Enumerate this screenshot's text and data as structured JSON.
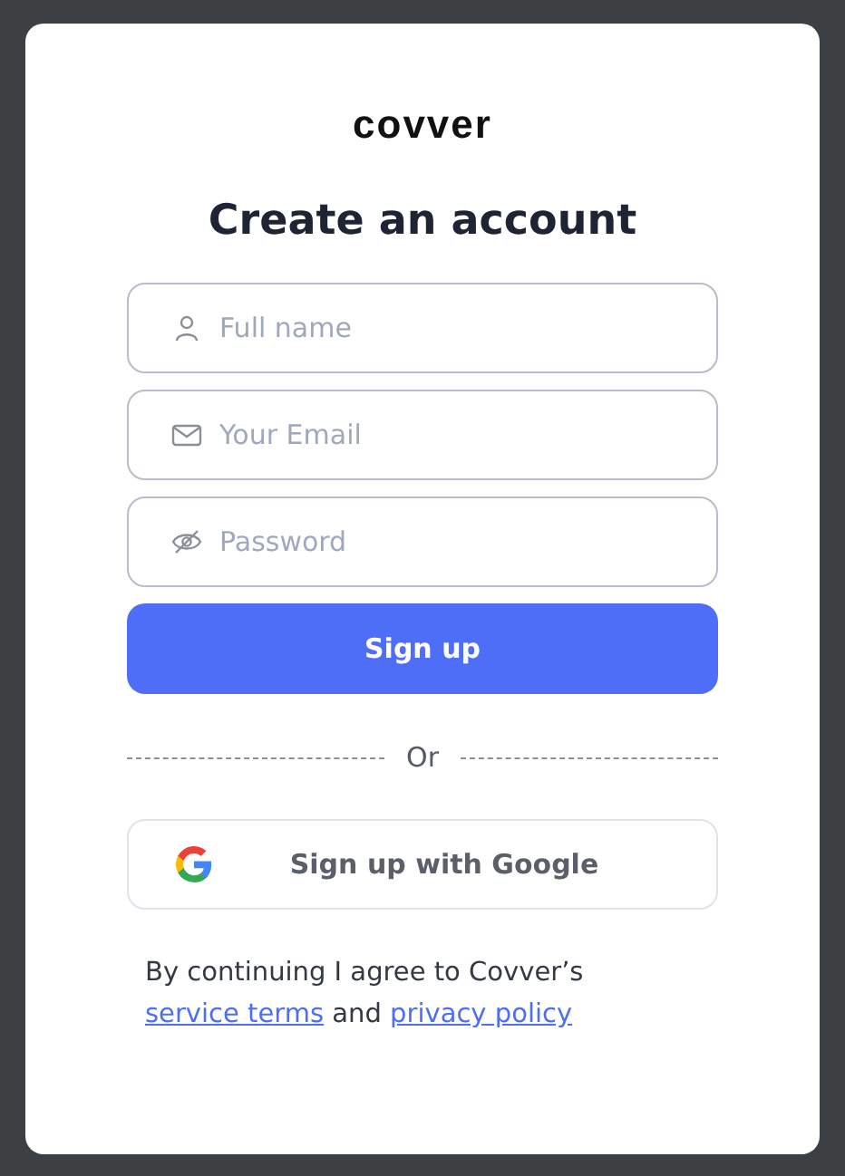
{
  "logo": "covver",
  "title": "Create an account",
  "fields": [
    {
      "kind": "user",
      "placeholder": "Full name"
    },
    {
      "kind": "mail",
      "placeholder": "Your Email"
    },
    {
      "kind": "eye-off",
      "placeholder": "Password"
    }
  ],
  "submit_button": "Sign up",
  "divider_text": "Or",
  "google_button": "Sign up with Google",
  "legal": {
    "prefix": "By continuing I agree to Covver’s",
    "link_1": "service terms",
    "middle": "and",
    "link_2": "privacy policy"
  }
}
